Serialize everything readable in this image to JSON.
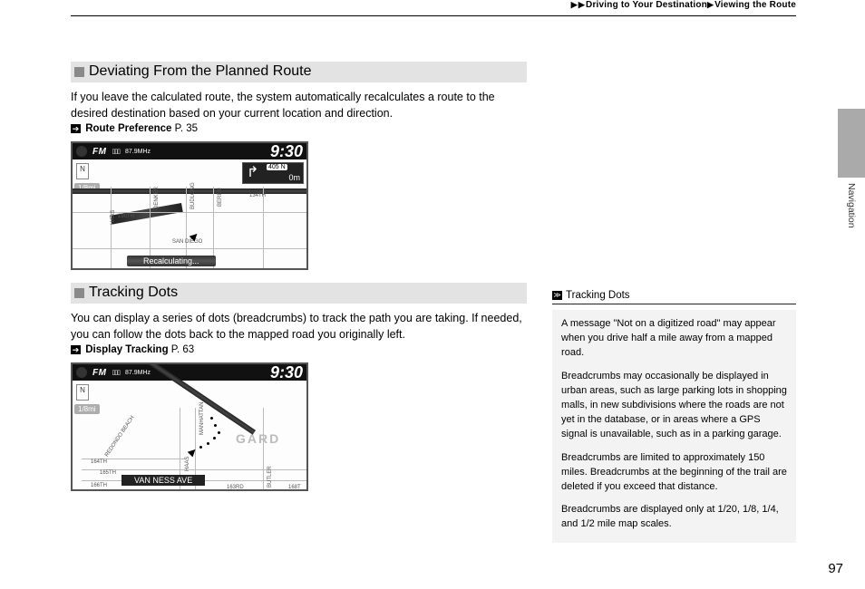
{
  "breadcrumb": {
    "part1": "Driving to Your Destination",
    "part2": "Viewing the Route"
  },
  "sideTabLabel": "Navigation",
  "pageNumber": "97",
  "section1": {
    "title": "Deviating From the Planned Route",
    "body": "If you leave the calculated route, the system automatically recalculates a route to the desired destination based on your current location and direction.",
    "refLabel": "Route Preference",
    "refPage": " P. 35"
  },
  "section2": {
    "title": "Tracking Dots",
    "body": "You can display a series of dots (breadcrumbs) to track the path you are taking. If needed, you can follow the dots back to the mapped road you originally left.",
    "refLabel": "Display Tracking",
    "refPage": " P. 63"
  },
  "screenshotA": {
    "fm": "FM",
    "freq": "87.9MHz",
    "clock": "9:30",
    "north": "N",
    "scale": "1/8mi",
    "route": "405 N",
    "distance": "0m",
    "status": "Recalculating...",
    "streets": {
      "a": "HAAS",
      "b": "DENKER",
      "c": "BUDLONG",
      "d": "BEREN",
      "e": "190TH",
      "f": "134TH",
      "g": "SAN DIEGO"
    }
  },
  "screenshotB": {
    "fm": "FM",
    "freq": "87.9MHz",
    "clock": "9:30",
    "north": "N",
    "scale": "1/8mi",
    "street": "VAN NESS AVE",
    "bg": "GARD",
    "streets": {
      "a": "164TH",
      "b": "165TH",
      "c": "166TH",
      "d": "HAAS",
      "e": "REDONDO BEACH",
      "f": "MANHATTAN",
      "g": "168T",
      "h": "163RD",
      "i": "BUTLER"
    }
  },
  "sidebar": {
    "heading": "Tracking Dots",
    "p1": "A message \"Not on a digitized road\" may appear when you drive half a mile away from a mapped road.",
    "p2": "Breadcrumbs may occasionally be displayed in urban areas, such as large parking lots in shopping malls, in new subdivisions where the roads are not yet in the database, or in areas where a GPS signal is unavailable, such as in a parking garage.",
    "p3": "Breadcrumbs are limited to approximately 150 miles. Breadcrumbs at the beginning of the trail are deleted if you exceed that distance.",
    "p4": "Breadcrumbs are displayed only at 1/20, 1/8, 1/4, and 1/2 mile map scales."
  }
}
